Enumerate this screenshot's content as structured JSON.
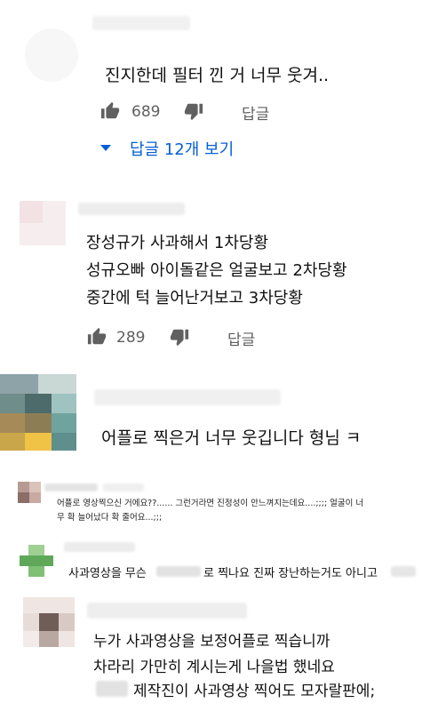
{
  "comment1": {
    "text": "진지한데 필터 낀 거 너무 웃겨..",
    "likes": "689",
    "reply_label": "답글",
    "view_replies": "답글 12개 보기"
  },
  "comment2": {
    "lines": [
      "장성규가 사과해서 1차당황",
      "성규오빠 아이돌같은 얼굴보고 2차당황",
      "중간에 턱 늘어난거보고 3차당황"
    ],
    "likes": "289",
    "reply_label": "답글"
  },
  "comment3": {
    "text": "어플로 찍은거 너무 웃깁니다 형님 ㅋ"
  },
  "comment4": {
    "lines": [
      "어플로 영상찍으신 거에요??...... 그런거라면 진정성이 안느껴지는데요....;;;; 얼굴이 너",
      "무 확 늘어났다 확 줄어요...;;;"
    ]
  },
  "comment5": {
    "text_a": "사과영상을 무슨",
    "text_b": "로 찍나요 진짜 장난하는거도 아니고"
  },
  "comment6": {
    "lines": [
      "누가 사과영상을 보정어플로 찍습니까",
      "차라리 가만히 계시는게 나을법 했네요",
      "제작진이 사과영상 찍어도 모자랄판에;"
    ]
  },
  "colors": {
    "accent": "#065fd4",
    "meta": "#606060"
  }
}
